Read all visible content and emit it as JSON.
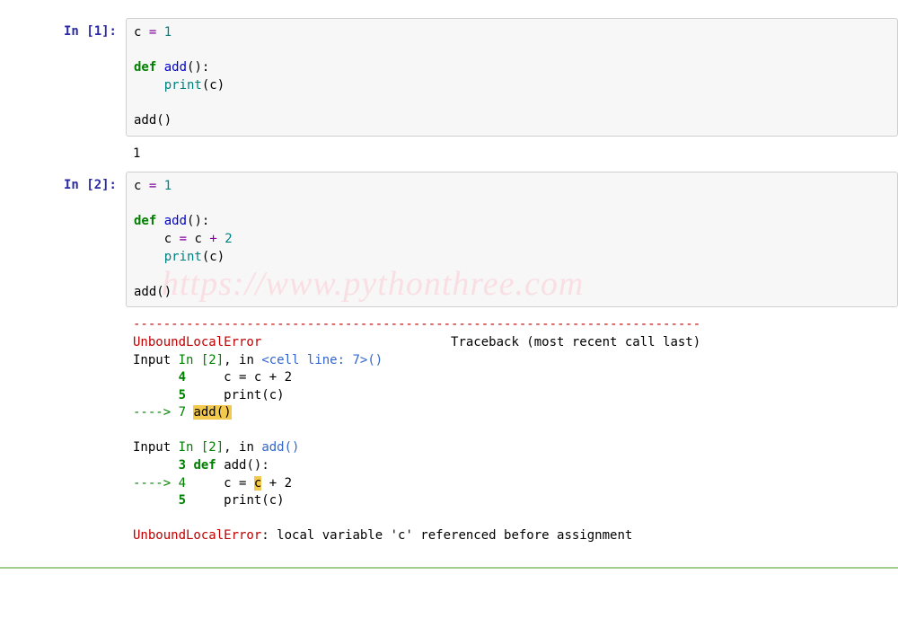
{
  "watermark": "https://www.pythonthree.com",
  "cell1": {
    "prompt": "In [1]:",
    "code": {
      "l1a": "c ",
      "l1b": "=",
      "l1c": " ",
      "l1d": "1",
      "l3a": "def",
      "l3b": " ",
      "l3c": "add",
      "l3d": "():",
      "l4a": "    ",
      "l4b": "print",
      "l4c": "(c)",
      "l6": "add()"
    },
    "output": "1"
  },
  "cell2": {
    "prompt": "In [2]:",
    "code": {
      "l1a": "c ",
      "l1b": "=",
      "l1c": " ",
      "l1d": "1",
      "l3a": "def",
      "l3b": " ",
      "l3c": "add",
      "l3d": "():",
      "l4a": "    c ",
      "l4b": "=",
      "l4c": " c ",
      "l4d": "+",
      "l4e": " ",
      "l4f": "2",
      "l5a": "    ",
      "l5b": "print",
      "l5c": "(c)",
      "l7": "add()"
    },
    "error": {
      "dashline": "---------------------------------------------------------------------------",
      "line1a": "UnboundLocalError",
      "line1b": "                         Traceback (most recent call last)",
      "line2a": "Input ",
      "line2b": "In [2]",
      "line2c": ", in ",
      "line2d": "<cell line: 7>",
      "line2e": "()",
      "line3a": "      ",
      "line3b": "4",
      "line3c": "     c ",
      "line3d": "=",
      "line3e": " c ",
      "line3f": "+",
      "line3g": " ",
      "line3h": "2",
      "line4a": "      ",
      "line4b": "5",
      "line4c": "     print(c)",
      "line5a": "----> ",
      "line5b": "7 ",
      "line5c": "add()",
      "line7a": "Input ",
      "line7b": "In [2]",
      "line7c": ", in ",
      "line7d": "add",
      "line7e": "()",
      "line8a": "      ",
      "line8b": "3",
      "line8c": " ",
      "line8d": "def",
      "line8e": " ",
      "line8f": "add",
      "line8g": "():",
      "line9a": "----> ",
      "line9b": "4",
      "line9c": "     c ",
      "line9d": "=",
      "line9e": " ",
      "line9f": "c",
      "line9g": " ",
      "line9h": "+",
      "line9i": " ",
      "line9j": "2",
      "line10a": "      ",
      "line10b": "5",
      "line10c": "     print(c)",
      "finala": "UnboundLocalError",
      "finalb": ": local variable 'c' referenced before assignment"
    }
  }
}
